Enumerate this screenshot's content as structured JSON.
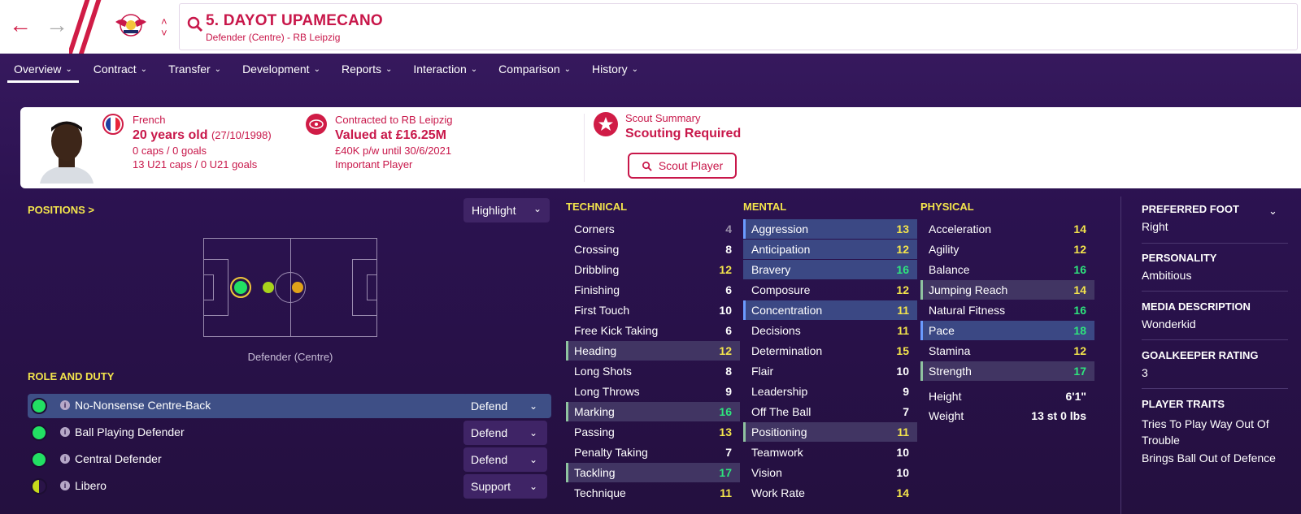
{
  "header": {
    "player_name": "5. DAYOT UPAMECANO",
    "player_sub": "Defender (Centre) - RB Leipzig"
  },
  "tabs": [
    {
      "label": "Overview"
    },
    {
      "label": "Contract"
    },
    {
      "label": "Transfer"
    },
    {
      "label": "Development"
    },
    {
      "label": "Reports"
    },
    {
      "label": "Interaction"
    },
    {
      "label": "Comparison"
    },
    {
      "label": "History"
    }
  ],
  "info": {
    "nationality": "French",
    "age": "20 years old",
    "dob": "(27/10/1998)",
    "caps": "0 caps / 0 goals",
    "u21_caps": "13 U21 caps / 0 U21 goals",
    "contract_label": "Contracted to RB Leipzig",
    "value": "Valued at £16.25M",
    "wage": "£40K p/w until 30/6/2021",
    "status": "Important Player",
    "scout_label": "Scout Summary",
    "scout_status": "Scouting Required",
    "scout_button": "Scout Player"
  },
  "positions": {
    "title": "POSITIONS >",
    "highlight": "Highlight",
    "pitch_label": "Defender (Centre)"
  },
  "roles": {
    "title": "ROLE AND DUTY",
    "items": [
      {
        "name": "No-Nonsense Centre-Back",
        "duty": "Defend"
      },
      {
        "name": "Ball Playing Defender",
        "duty": "Defend"
      },
      {
        "name": "Central Defender",
        "duty": "Defend"
      },
      {
        "name": "Libero",
        "duty": "Support"
      }
    ]
  },
  "technical": {
    "title": "TECHNICAL",
    "items": [
      {
        "name": "Corners",
        "value": "4"
      },
      {
        "name": "Crossing",
        "value": "8"
      },
      {
        "name": "Dribbling",
        "value": "12"
      },
      {
        "name": "Finishing",
        "value": "6"
      },
      {
        "name": "First Touch",
        "value": "10"
      },
      {
        "name": "Free Kick Taking",
        "value": "6"
      },
      {
        "name": "Heading",
        "value": "12"
      },
      {
        "name": "Long Shots",
        "value": "8"
      },
      {
        "name": "Long Throws",
        "value": "9"
      },
      {
        "name": "Marking",
        "value": "16"
      },
      {
        "name": "Passing",
        "value": "13"
      },
      {
        "name": "Penalty Taking",
        "value": "7"
      },
      {
        "name": "Tackling",
        "value": "17"
      },
      {
        "name": "Technique",
        "value": "11"
      }
    ]
  },
  "mental": {
    "title": "MENTAL",
    "items": [
      {
        "name": "Aggression",
        "value": "13"
      },
      {
        "name": "Anticipation",
        "value": "12"
      },
      {
        "name": "Bravery",
        "value": "16"
      },
      {
        "name": "Composure",
        "value": "12"
      },
      {
        "name": "Concentration",
        "value": "11"
      },
      {
        "name": "Decisions",
        "value": "11"
      },
      {
        "name": "Determination",
        "value": "15"
      },
      {
        "name": "Flair",
        "value": "10"
      },
      {
        "name": "Leadership",
        "value": "9"
      },
      {
        "name": "Off The Ball",
        "value": "7"
      },
      {
        "name": "Positioning",
        "value": "11"
      },
      {
        "name": "Teamwork",
        "value": "10"
      },
      {
        "name": "Vision",
        "value": "10"
      },
      {
        "name": "Work Rate",
        "value": "14"
      }
    ]
  },
  "physical": {
    "title": "PHYSICAL",
    "items": [
      {
        "name": "Acceleration",
        "value": "14"
      },
      {
        "name": "Agility",
        "value": "12"
      },
      {
        "name": "Balance",
        "value": "16"
      },
      {
        "name": "Jumping Reach",
        "value": "14"
      },
      {
        "name": "Natural Fitness",
        "value": "16"
      },
      {
        "name": "Pace",
        "value": "18"
      },
      {
        "name": "Stamina",
        "value": "12"
      },
      {
        "name": "Strength",
        "value": "17"
      }
    ],
    "height_label": "Height",
    "height_value": "6'1\"",
    "weight_label": "Weight",
    "weight_value": "13 st 0 lbs"
  },
  "profile": {
    "preferred_foot_label": "PREFERRED FOOT",
    "preferred_foot": "Right",
    "personality_label": "PERSONALITY",
    "personality": "Ambitious",
    "media_label": "MEDIA DESCRIPTION",
    "media": "Wonderkid",
    "gk_label": "GOALKEEPER RATING",
    "gk": "3",
    "traits_label": "PLAYER TRAITS",
    "trait_1": "Tries To Play Way Out Of Trouble",
    "trait_2": "Brings Ball Out of Defence"
  },
  "colors": {
    "accent": "#d01c46",
    "background": "#2a1448",
    "attribute_yellow": "#f3e44c",
    "attribute_green": "#2ee57d"
  }
}
